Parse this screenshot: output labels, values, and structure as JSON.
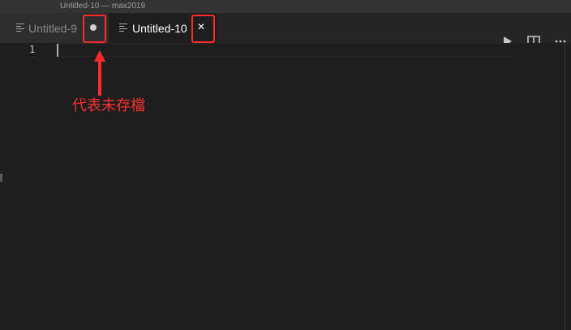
{
  "window": {
    "title": "Untitled-10 — max2019"
  },
  "tabs": [
    {
      "label": "Untitled-9",
      "state": "unsaved"
    },
    {
      "label": "Untitled-10",
      "state": "active"
    }
  ],
  "editor": {
    "line_numbers": [
      "1"
    ]
  },
  "annotation": {
    "text": "代表未存檔",
    "color": "#ff2b2b"
  },
  "icons": {
    "run": "run-icon",
    "split": "split-editor-icon",
    "more": "more-actions-icon",
    "dirty": "unsaved-dot-icon",
    "close": "close-icon",
    "file": "file-icon"
  }
}
